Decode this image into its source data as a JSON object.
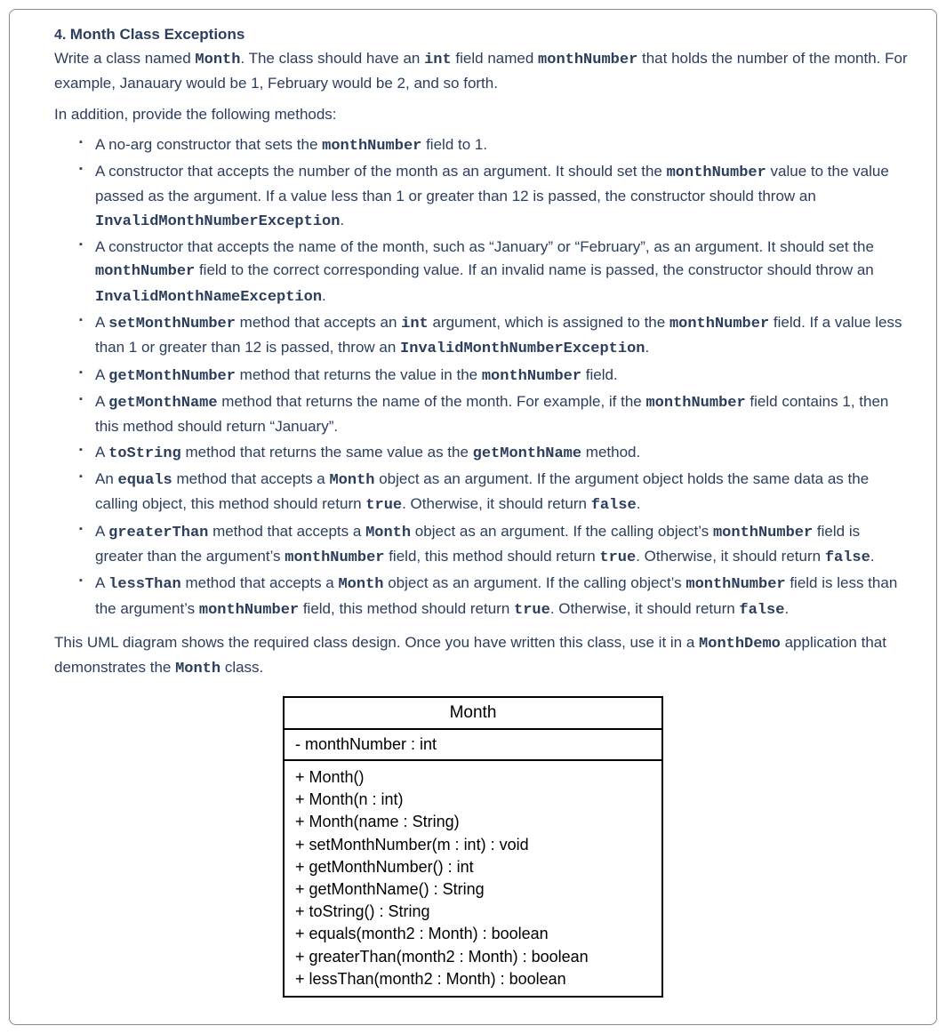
{
  "question": {
    "number": "4.",
    "title": "Month Class Exceptions",
    "intro_part1": "Write a class named ",
    "intro_code1": "Month",
    "intro_part2": ". The class should have an ",
    "intro_code2": "int",
    "intro_part3": " field named ",
    "intro_code3": "monthNumber",
    "intro_part4": " that holds the number of the month. For example, Janauary would be 1, February would be 2, and so forth.",
    "intro2": "In addition, provide the following methods:",
    "requirements": [
      {
        "segments": [
          {
            "t": "text",
            "v": "A no-arg constructor that sets the "
          },
          {
            "t": "code",
            "v": "monthNumber"
          },
          {
            "t": "text",
            "v": " field to 1."
          }
        ]
      },
      {
        "segments": [
          {
            "t": "text",
            "v": "A constructor that accepts the number of the month as an argument. It should set the "
          },
          {
            "t": "code",
            "v": "monthNumber"
          },
          {
            "t": "text",
            "v": " value to the value passed as the argument. If a value less than 1 or greater than 12 is passed, the constructor should throw an "
          },
          {
            "t": "code",
            "v": "InvalidMonthNumberException"
          },
          {
            "t": "text",
            "v": "."
          }
        ]
      },
      {
        "segments": [
          {
            "t": "text",
            "v": "A constructor that accepts the name of the month, such as “January” or “February”, as an argument. It should set the "
          },
          {
            "t": "code",
            "v": "monthNumber"
          },
          {
            "t": "text",
            "v": " field to the correct corresponding value. If an invalid name is passed, the constructor should throw an "
          },
          {
            "t": "code",
            "v": "InvalidMonthNameException"
          },
          {
            "t": "text",
            "v": "."
          }
        ]
      },
      {
        "segments": [
          {
            "t": "text",
            "v": "A "
          },
          {
            "t": "code",
            "v": "setMonthNumber"
          },
          {
            "t": "text",
            "v": " method that accepts an "
          },
          {
            "t": "code",
            "v": "int"
          },
          {
            "t": "text",
            "v": " argument, which is assigned to the "
          },
          {
            "t": "code",
            "v": "monthNumber"
          },
          {
            "t": "text",
            "v": " field. If a value less than 1 or greater than 12 is passed, throw an "
          },
          {
            "t": "code",
            "v": "InvalidMonthNumberException"
          },
          {
            "t": "text",
            "v": "."
          }
        ]
      },
      {
        "segments": [
          {
            "t": "text",
            "v": "A "
          },
          {
            "t": "code",
            "v": "getMonthNumber"
          },
          {
            "t": "text",
            "v": " method that returns the value in the "
          },
          {
            "t": "code",
            "v": "monthNumber"
          },
          {
            "t": "text",
            "v": " field."
          }
        ]
      },
      {
        "segments": [
          {
            "t": "text",
            "v": "A "
          },
          {
            "t": "code",
            "v": "getMonthName"
          },
          {
            "t": "text",
            "v": " method that returns the name of the month. For example, if the "
          },
          {
            "t": "code",
            "v": "monthNumber"
          },
          {
            "t": "text",
            "v": " field contains 1, then this method should return “January”."
          }
        ]
      },
      {
        "segments": [
          {
            "t": "text",
            "v": "A "
          },
          {
            "t": "code",
            "v": "toString"
          },
          {
            "t": "text",
            "v": " method that returns the same value as the "
          },
          {
            "t": "code",
            "v": "getMonthName"
          },
          {
            "t": "text",
            "v": " method."
          }
        ]
      },
      {
        "segments": [
          {
            "t": "text",
            "v": "An "
          },
          {
            "t": "code",
            "v": "equals"
          },
          {
            "t": "text",
            "v": " method that accepts a "
          },
          {
            "t": "code",
            "v": "Month"
          },
          {
            "t": "text",
            "v": " object as an argument. If the argument object holds the same data as the calling object, this method should return "
          },
          {
            "t": "code",
            "v": "true"
          },
          {
            "t": "text",
            "v": ". Otherwise, it should return "
          },
          {
            "t": "code",
            "v": "false"
          },
          {
            "t": "text",
            "v": "."
          }
        ]
      },
      {
        "segments": [
          {
            "t": "text",
            "v": "A "
          },
          {
            "t": "code",
            "v": "greaterThan"
          },
          {
            "t": "text",
            "v": " method that accepts a "
          },
          {
            "t": "code",
            "v": "Month"
          },
          {
            "t": "text",
            "v": " object as an argument. If the calling object’s "
          },
          {
            "t": "code",
            "v": "monthNumber"
          },
          {
            "t": "text",
            "v": " field is greater than the argument’s "
          },
          {
            "t": "code",
            "v": "monthNumber"
          },
          {
            "t": "text",
            "v": " field, this method should return "
          },
          {
            "t": "code",
            "v": "true"
          },
          {
            "t": "text",
            "v": ". Otherwise, it should return "
          },
          {
            "t": "code",
            "v": "false"
          },
          {
            "t": "text",
            "v": "."
          }
        ]
      },
      {
        "segments": [
          {
            "t": "text",
            "v": "A "
          },
          {
            "t": "code",
            "v": "lessThan"
          },
          {
            "t": "text",
            "v": " method that accepts a "
          },
          {
            "t": "code",
            "v": "Month"
          },
          {
            "t": "text",
            "v": " object as an argument. If the calling object’s "
          },
          {
            "t": "code",
            "v": "monthNumber"
          },
          {
            "t": "text",
            "v": " field is less than the argument’s "
          },
          {
            "t": "code",
            "v": "monthNumber"
          },
          {
            "t": "text",
            "v": " field, this method should return "
          },
          {
            "t": "code",
            "v": "true"
          },
          {
            "t": "text",
            "v": ". Otherwise, it should return "
          },
          {
            "t": "code",
            "v": "false"
          },
          {
            "t": "text",
            "v": "."
          }
        ]
      }
    ],
    "closing_part1": "This UML diagram shows the required class design. Once you have written this class, use it in a ",
    "closing_code1": "MonthDemo",
    "closing_part2": " application that demonstrates the ",
    "closing_code2": "Month",
    "closing_part3": " class."
  },
  "uml": {
    "class_name": "Month",
    "fields": [
      "- monthNumber : int"
    ],
    "methods": [
      "+ Month()",
      "+ Month(n : int)",
      "+ Month(name : String)",
      "+ setMonthNumber(m : int) : void",
      "+ getMonthNumber() : int",
      "+ getMonthName() : String",
      "+ toString() : String",
      "+ equals(month2 : Month) : boolean",
      "+ greaterThan(month2 : Month) : boolean",
      "+ lessThan(month2 : Month) : boolean"
    ]
  }
}
